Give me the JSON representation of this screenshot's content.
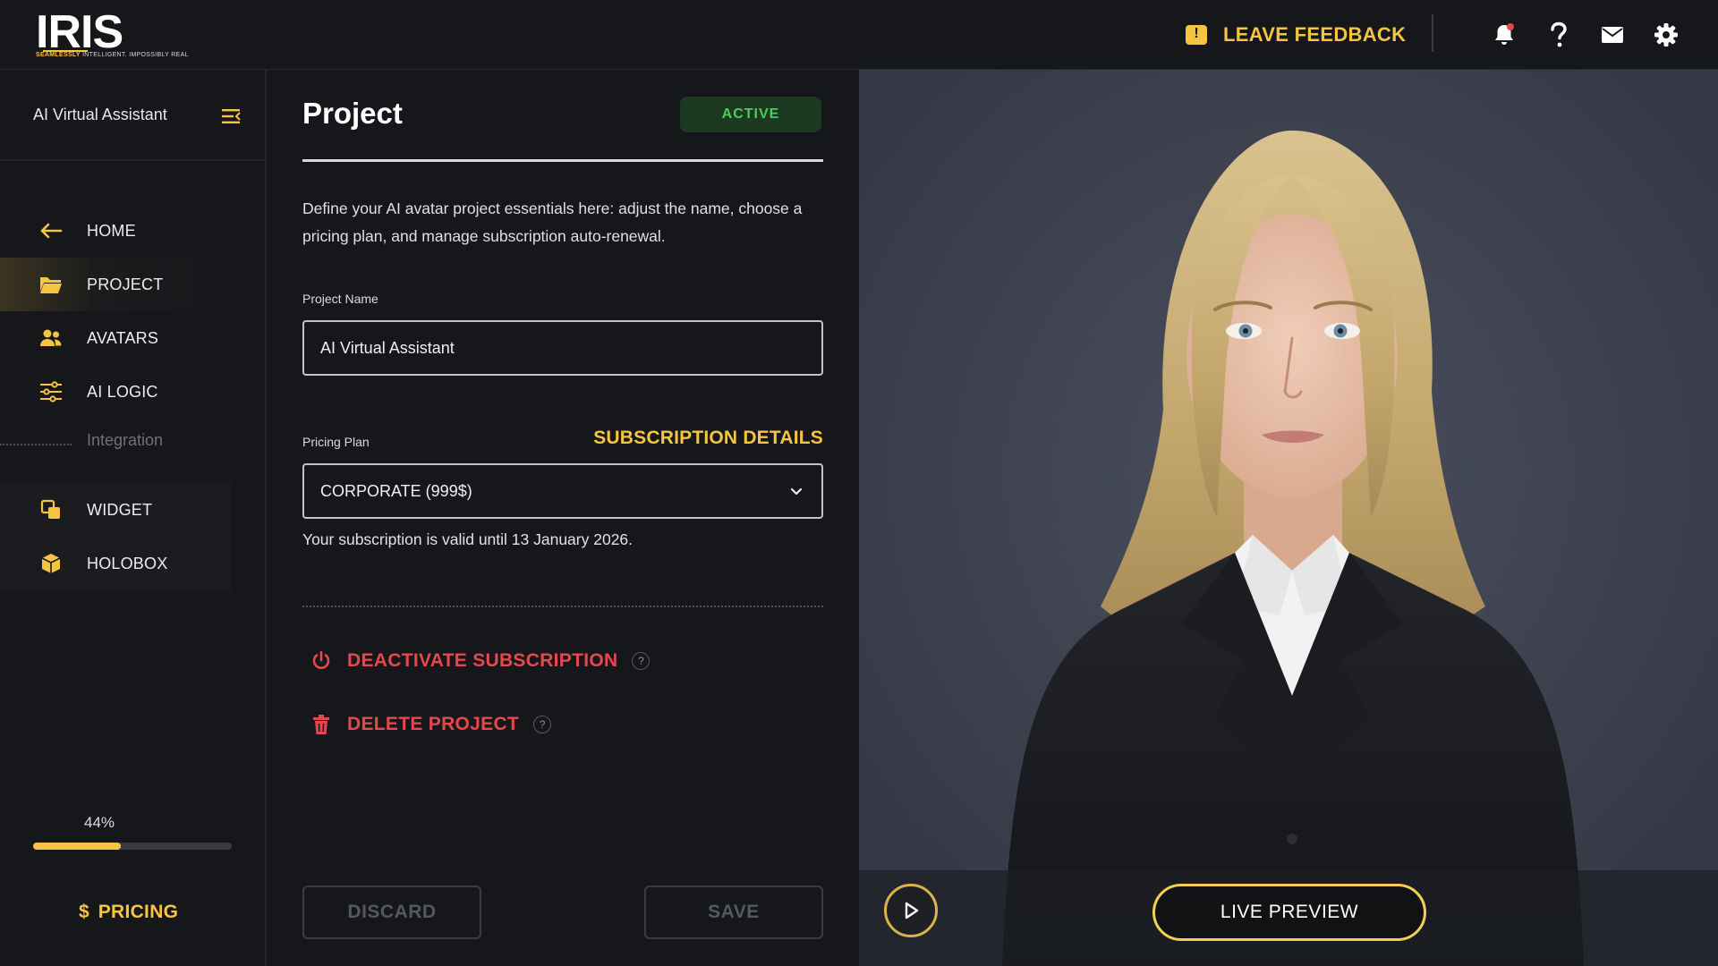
{
  "app": {
    "logo_text": "IRIS",
    "logo_tagline_prefix": "INTELLIGENT. IMPOSSIBLY REAL",
    "logo_tagline_highlight": "SEAMLESSLY"
  },
  "topbar": {
    "feedback_label": "LEAVE FEEDBACK",
    "icons": [
      "bell-icon",
      "help-icon",
      "mail-icon",
      "settings-icon"
    ],
    "notification_dot_color": "#e5484d"
  },
  "sidebar": {
    "title": "AI Virtual Assistant",
    "nav": [
      {
        "label": "HOME",
        "icon": "arrow-left-icon"
      },
      {
        "label": "PROJECT",
        "icon": "folder-icon",
        "active": true
      },
      {
        "label": "AVATARS",
        "icon": "users-icon"
      },
      {
        "label": "AI LOGIC",
        "icon": "sliders-icon"
      }
    ],
    "section_label": "Integration",
    "integrations": [
      {
        "label": "WIDGET",
        "icon": "widget-icon"
      },
      {
        "label": "HOLOBOX",
        "icon": "cube-icon"
      }
    ],
    "progress": {
      "label": "44%",
      "value": 0.44
    },
    "pricing_symbol": "$",
    "pricing_label": "PRICING"
  },
  "project": {
    "title": "Project",
    "status": "ACTIVE",
    "description": "Define your AI avatar project essentials here: adjust the name, choose a pricing plan, and manage subscription auto-renewal.",
    "name_label": "Project Name",
    "name_value": "AI Virtual Assistant",
    "plan_label": "Pricing Plan",
    "subscription_link": "SUBSCRIPTION DETAILS",
    "plan_value": "CORPORATE (999$)",
    "valid_text": "Your subscription is valid until 13 January 2026.",
    "deactivate_label": "DEACTIVATE SUBSCRIPTION",
    "delete_label": "DELETE PROJECT",
    "help_glyph": "?",
    "discard_label": "DISCARD",
    "save_label": "SAVE"
  },
  "preview": {
    "live_label": "LIVE PREVIEW"
  },
  "colors": {
    "accent": "#f5c542",
    "danger": "#e5484d",
    "success": "#4fcb5c",
    "background": "#15171a",
    "preview_bg": "#3d4250"
  }
}
